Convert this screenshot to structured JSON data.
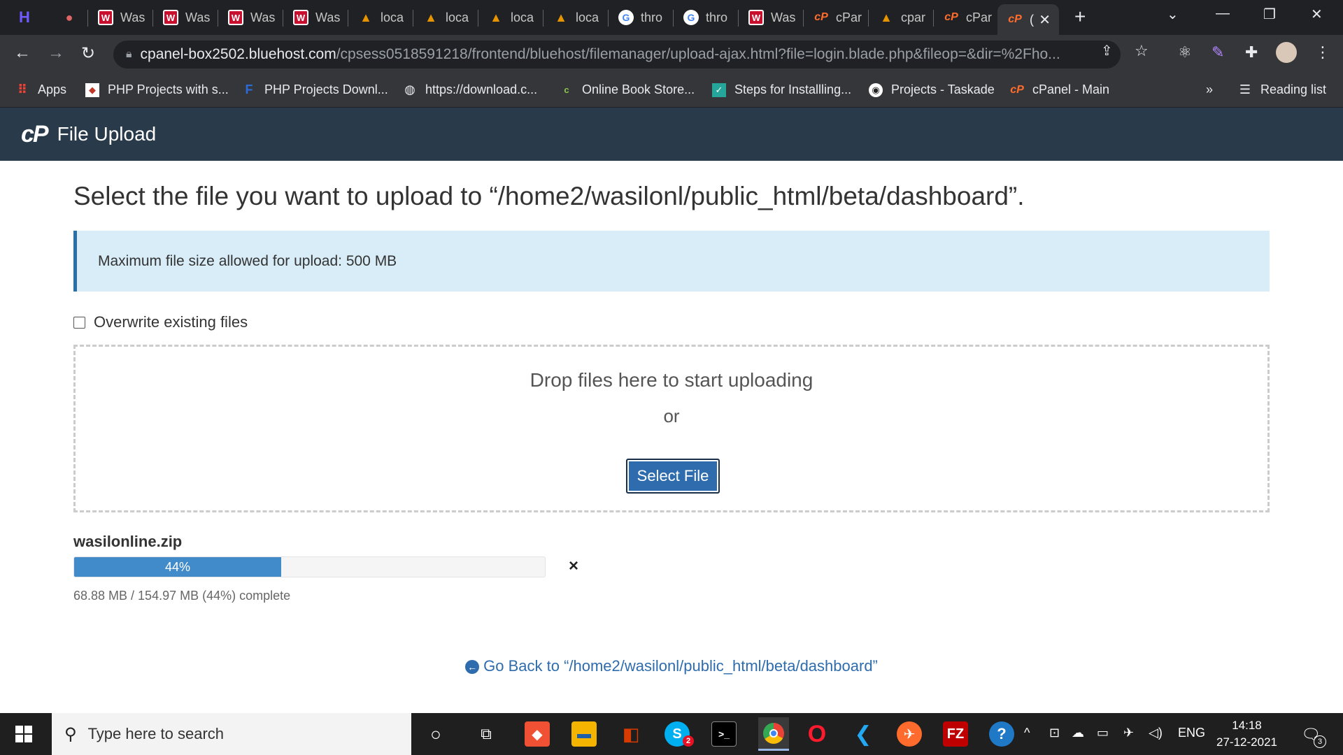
{
  "browser": {
    "tabs": [
      {
        "icon": "h-logo-icon",
        "title": ""
      },
      {
        "icon": "dots-icon",
        "title": ""
      },
      {
        "icon": "w-icon",
        "title": "Was"
      },
      {
        "icon": "w-icon",
        "title": "Was"
      },
      {
        "icon": "w-icon",
        "title": "Was"
      },
      {
        "icon": "w-icon",
        "title": "Was"
      },
      {
        "icon": "xampp-icon",
        "title": "loca"
      },
      {
        "icon": "xampp-icon",
        "title": "loca"
      },
      {
        "icon": "xampp-icon",
        "title": "loca"
      },
      {
        "icon": "xampp-icon",
        "title": "loca"
      },
      {
        "icon": "google-icon",
        "title": "thro"
      },
      {
        "icon": "google-icon",
        "title": "thro"
      },
      {
        "icon": "w-icon",
        "title": "Was"
      },
      {
        "icon": "cpanel-icon",
        "title": "cPar"
      },
      {
        "icon": "xampp-icon",
        "title": "cpar"
      },
      {
        "icon": "cpanel-icon",
        "title": "cPar"
      },
      {
        "icon": "cpanel-icon",
        "title": "("
      }
    ],
    "url_host": "cpanel-box2502.bluehost.com",
    "url_path": "/cpsess0518591218/frontend/bluehost/filemanager/upload-ajax.html?file=login.blade.php&fileop=&dir=%2Fho...",
    "bookmarks": [
      {
        "label": "Apps",
        "icon": "apps-grid-icon"
      },
      {
        "label": "PHP Projects with s...",
        "icon": "php-projects-icon"
      },
      {
        "label": "PHP Projects Downl...",
        "icon": "f-icon"
      },
      {
        "label": "https://download.c...",
        "icon": "globe-icon"
      },
      {
        "label": "Online Book Store...",
        "icon": "c-icon"
      },
      {
        "label": "Steps for Installling...",
        "icon": "steps-icon"
      },
      {
        "label": "Projects - Taskade",
        "icon": "taskade-icon"
      },
      {
        "label": "cPanel - Main",
        "icon": "cpanel-icon"
      }
    ],
    "bookmarks_more": "»",
    "reading_list": "Reading list"
  },
  "header": {
    "logo": "cP",
    "title": "File Upload"
  },
  "main": {
    "heading": "Select the file you want to upload to “/home2/wasilonl/public_html/beta/dashboard”.",
    "alert": "Maximum file size allowed for upload: 500 MB",
    "overwrite_label": "Overwrite existing files",
    "drop_text": "Drop files here to start uploading",
    "or_text": "or",
    "select_button": "Select File",
    "upload": {
      "filename": "wasilonline.zip",
      "progress_fraction": 0.44,
      "progress_label": "44%",
      "status": "68.88 MB / 154.97 MB (44%) complete",
      "cancel": "×"
    },
    "go_back": "Go Back to “/home2/wasilonl/public_html/beta/dashboard”"
  },
  "taskbar": {
    "search_placeholder": "Type here to search",
    "language": "ENG",
    "time": "14:18",
    "date": "27-12-2021",
    "notification_count": "3",
    "skype_badge": "2"
  }
}
